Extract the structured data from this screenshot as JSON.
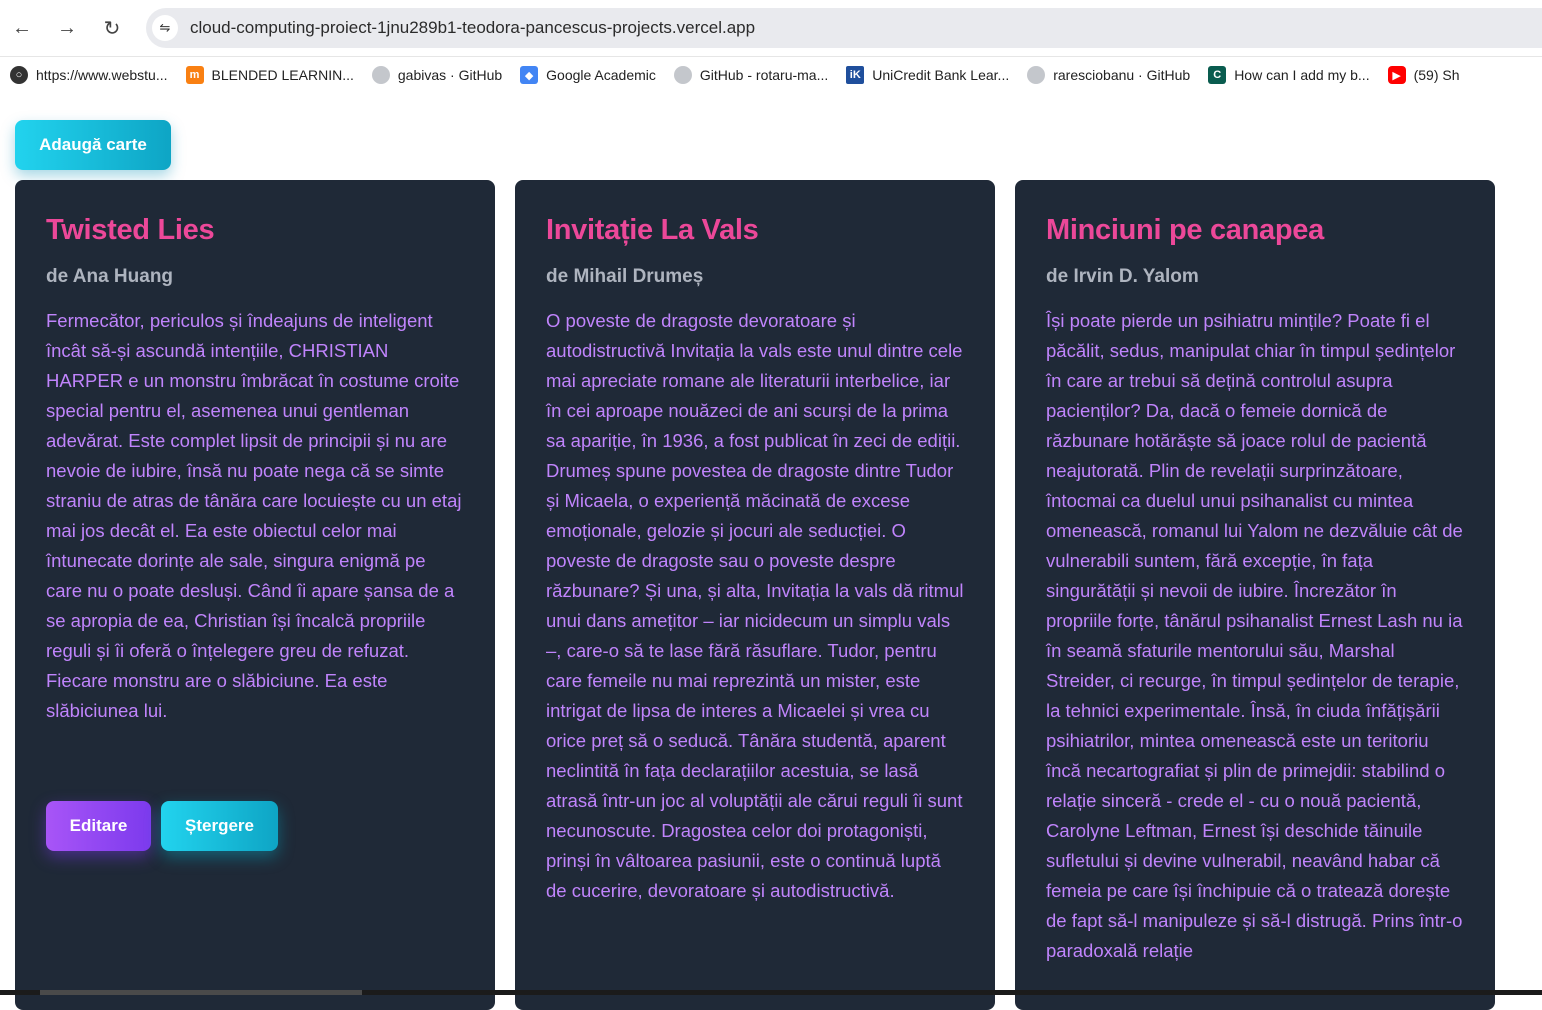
{
  "browser": {
    "url": "cloud-computing-proiect-1jnu289b1-teodora-pancescus-projects.vercel.app",
    "bookmarks": [
      {
        "label": "https://www.webstu...",
        "icon": "globe-icon",
        "color": "#333333"
      },
      {
        "label": "BLENDED LEARNIN...",
        "icon": "moodle-icon",
        "color": "#f98012"
      },
      {
        "label": "gabivas · GitHub",
        "icon": "github-icon",
        "color": "#9aa0a6"
      },
      {
        "label": "Google Academic",
        "icon": "google-scholar-icon",
        "color": "#4285f4"
      },
      {
        "label": "GitHub - rotaru-ma...",
        "icon": "github-icon",
        "color": "#9aa0a6"
      },
      {
        "label": "UniCredit Bank Lear...",
        "icon": "unicredit-icon",
        "color": "#1f4f9c"
      },
      {
        "label": "raresciobanu · GitHub",
        "icon": "github-icon",
        "color": "#9aa0a6"
      },
      {
        "label": "How can I add my b...",
        "icon": "codecademy-icon",
        "color": "#0a5c4f"
      },
      {
        "label": "(59) Sh",
        "icon": "youtube-icon",
        "color": "#ff0000"
      }
    ]
  },
  "page": {
    "add_button": "Adaugă carte",
    "books": [
      {
        "title": "Twisted Lies",
        "author": "de Ana Huang",
        "description": "Fermecător, periculos și îndeajuns de inteligent încât să-și ascundă intențiile, CHRISTIAN HARPER e un monstru îmbrăcat în costume croite special pentru el, asemenea unui gentleman adevărat. Este complet lipsit de principii și nu are nevoie de iubire, însă nu poate nega că se simte straniu de atras de tânăra care locuiește cu un etaj mai jos decât el. Ea este obiectul celor mai întunecate dorințe ale sale, singura enigmă pe care nu o poate desluși. Când îi apare șansa de a se apropia de ea, Christian își încalcă propriile reguli și îi oferă o înțelegere greu de refuzat. Fiecare monstru are o slăbiciune. Ea este slăbiciunea lui.",
        "edit_label": "Editare",
        "delete_label": "Ștergere"
      },
      {
        "title": "Invitație La Vals",
        "author": "de Mihail Drumeș",
        "description": "O poveste de dragoste devoratoare și autodistructivă Invitația la vals este unul dintre cele mai apreciate romane ale literaturii interbelice, iar în cei aproape nouăzeci de ani scurși de la prima sa apariție, în 1936, a fost publicat în zeci de ediții. Drumeș spune povestea de dragoste dintre Tudor și Micaela, o experiență măcinată de excese emoționale, gelozie și jocuri ale seducției. O poveste de dragoste sau o poveste despre răzbunare? Și una, și alta, Invitația la vals dă ritmul unui dans amețitor – iar nicidecum un simplu vals –, care-o să te lase fără răsuflare. Tudor, pentru care femeile nu mai reprezintă un mister, este intrigat de lipsa de interes a Micaelei și vrea cu orice preț să o seducă. Tânăra studentă, aparent neclintită în fața declarațiilor acestuia, se lasă atrasă într-un joc al voluptății ale cărui reguli îi sunt necunoscute. Dragostea celor doi protagoniști, prinși în vâltoarea pasiunii, este o continuă luptă de cucerire, devoratoare și autodistructivă."
      },
      {
        "title": "Minciuni pe canapea",
        "author": "de Irvin D. Yalom",
        "description": "Își poate pierde un psihiatru mințile? Poate fi el păcălit, sedus, manipulat chiar în timpul ședințelor în care ar trebui să dețină controlul asupra pacienților? Da, dacă o femeie dornică de răzbunare hotărăște să joace rolul de pacientă neajutorată. Plin de revelații surprinzătoare, întocmai ca duelul unui psihanalist cu mintea omenească, romanul lui Yalom ne dezvăluie cât de vulnerabili suntem, fără excepție, în fața singurătății și nevoii de iubire. Încrezător în propriile forțe, tânărul psihanalist Ernest Lash nu ia în seamă sfaturile mentorului său, Marshal Streider, ci recurge, în timpul ședințelor de terapie, la tehnici experimentale. Însă, în ciuda înfățișării psihiatrilor, mintea omenească este un teritoriu încă necartografiat și plin de primejdii: stabilind o relație sinceră - crede el - cu o nouă pacientă, Carolyne Leftman, Ernest își deschide tăinuile sufletului și devine vulnerabil, neavând habar că femeia pe care își închipuie că o tratează dorește de fapt să-l manipuleze și să-l distrugă. Prins într-o paradoxală relație"
      }
    ]
  }
}
